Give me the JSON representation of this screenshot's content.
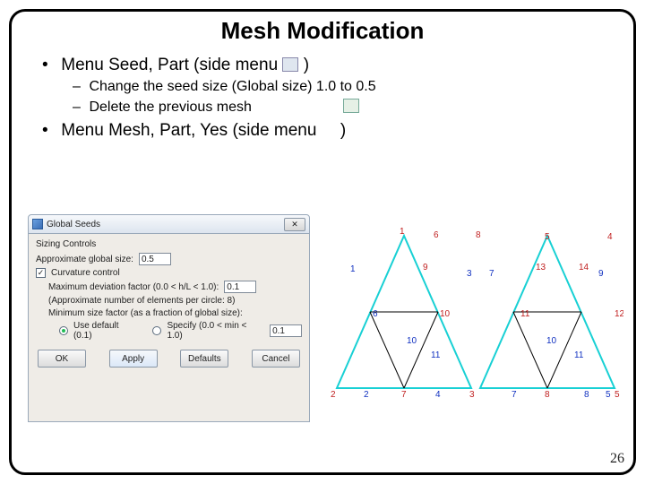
{
  "title": "Mesh Modification",
  "bullets": {
    "b1a_pre": "Menu Seed, Part (side menu",
    "b1a_post": ")",
    "b2a": "Change the seed size (Global size) 1.0 to 0.5",
    "b2b": "Delete the previous mesh",
    "b1b_pre": "Menu Mesh, Part, Yes (side menu",
    "b1b_post": ")"
  },
  "dialog": {
    "title": "Global Seeds",
    "close_glyph": "✕",
    "group_title": "Sizing Controls",
    "approx_label": "Approximate global size:",
    "approx_value": "0.5",
    "curvature_label": "Curvature control",
    "max_dev_label": "Maximum deviation factor (0.0 < h/L < 1.0):",
    "max_dev_value": "0.1",
    "approx_elems_label": "(Approximate number of elements per circle: 8)",
    "min_size_label": "Minimum size factor (as a fraction of global size):",
    "use_default_label": "Use default (0.1)",
    "specify_label": "Specify (0.0 < min < 1.0)",
    "specify_value": "0.1",
    "btn_ok": "OK",
    "btn_apply": "Apply",
    "btn_defaults": "Defaults",
    "btn_cancel": "Cancel"
  },
  "chart_data": {
    "type": "diagram",
    "description": "Two adjacent triangular finite-element meshes with labeled nodes (red) and edges (blue), drawn with cyan outlines and black internal lines.",
    "node_labels": [
      "1",
      "2",
      "3",
      "4",
      "5",
      "6",
      "7",
      "8",
      "9",
      "10",
      "11",
      "12",
      "13",
      "14"
    ],
    "edge_labels": [
      "1",
      "2",
      "3",
      "4",
      "5",
      "6",
      "7",
      "8",
      "9",
      "10",
      "10",
      "11",
      "11",
      "12"
    ]
  },
  "pagenum": "26"
}
